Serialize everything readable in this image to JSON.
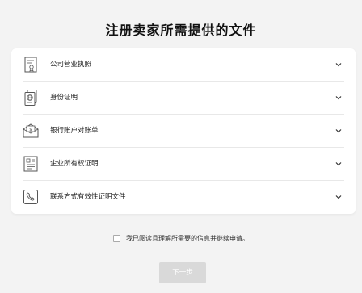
{
  "page": {
    "title": "注册卖家所需提供的文件"
  },
  "documents": [
    {
      "label": "公司营业执照",
      "icon": "business-license-icon"
    },
    {
      "label": "身份证明",
      "icon": "passport-icon"
    },
    {
      "label": "银行账户对账单",
      "icon": "bank-statement-icon"
    },
    {
      "label": "企业所有权证明",
      "icon": "ownership-document-icon"
    },
    {
      "label": "联系方式有效性证明文件",
      "icon": "phone-icon"
    }
  ],
  "agreement": {
    "text": "我已阅读且理解所需要的信息并继续申请。",
    "checked": false
  },
  "actions": {
    "next_label": "下一步"
  },
  "colors": {
    "background": "#f3f3f3",
    "card": "#ffffff",
    "button_disabled": "#d9d9d9"
  }
}
